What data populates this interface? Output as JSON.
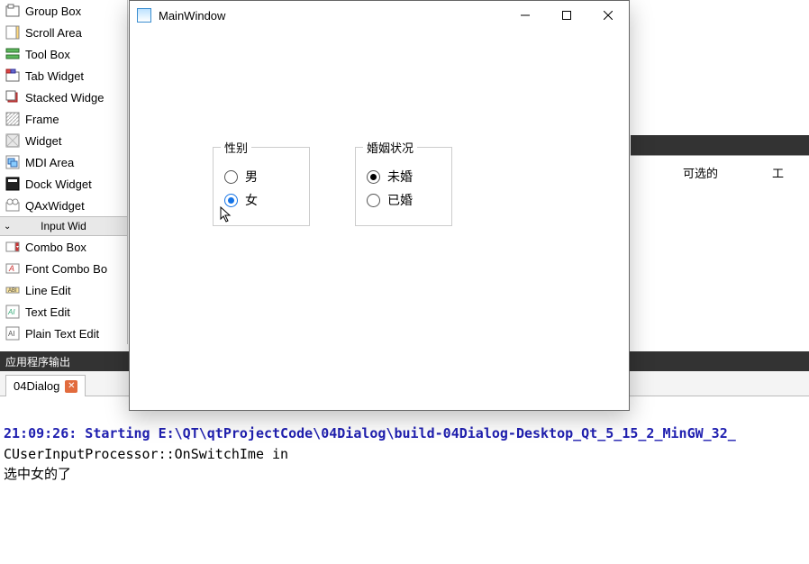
{
  "palette": {
    "items": [
      {
        "label": "Group Box",
        "icon": "groupbox-icon"
      },
      {
        "label": "Scroll Area",
        "icon": "scrollarea-icon"
      },
      {
        "label": "Tool Box",
        "icon": "toolbox-icon"
      },
      {
        "label": "Tab Widget",
        "icon": "tabwidget-icon"
      },
      {
        "label": "Stacked Widge",
        "icon": "stackedwidget-icon"
      },
      {
        "label": "Frame",
        "icon": "frame-icon"
      },
      {
        "label": "Widget",
        "icon": "widget-icon"
      },
      {
        "label": "MDI Area",
        "icon": "mdiarea-icon"
      },
      {
        "label": "Dock Widget",
        "icon": "dockwidget-icon"
      },
      {
        "label": "QAxWidget",
        "icon": "qaxwidget-icon"
      }
    ],
    "section_label": "Input Wid",
    "items2": [
      {
        "label": "Combo Box",
        "icon": "combobox-icon"
      },
      {
        "label": "Font Combo Bo",
        "icon": "fontcombobox-icon"
      },
      {
        "label": "Line Edit",
        "icon": "lineedit-icon"
      },
      {
        "label": "Text Edit",
        "icon": "textedit-icon"
      },
      {
        "label": "Plain Text Edit",
        "icon": "plaintextedit-icon"
      }
    ]
  },
  "rightpane": {
    "label_selectable": "可选的",
    "label_tool": "工"
  },
  "output_panel": {
    "title": "应用程序输出",
    "tab": "04Dialog"
  },
  "console": {
    "line1": "21:09:26: Starting E:\\QT\\qtProjectCode\\04Dialog\\build-04Dialog-Desktop_Qt_5_15_2_MinGW_32_",
    "line2": "CUserInputProcessor::OnSwitchIme in",
    "line3": "选中女的了"
  },
  "appwin": {
    "title": "MainWindow",
    "group1": {
      "legend": "性别",
      "options": [
        {
          "label": "男",
          "checked": false
        },
        {
          "label": "女",
          "checked": true
        }
      ]
    },
    "group2": {
      "legend": "婚姻状况",
      "options": [
        {
          "label": "未婚",
          "checked": true
        },
        {
          "label": "已婚",
          "checked": false
        }
      ]
    }
  }
}
